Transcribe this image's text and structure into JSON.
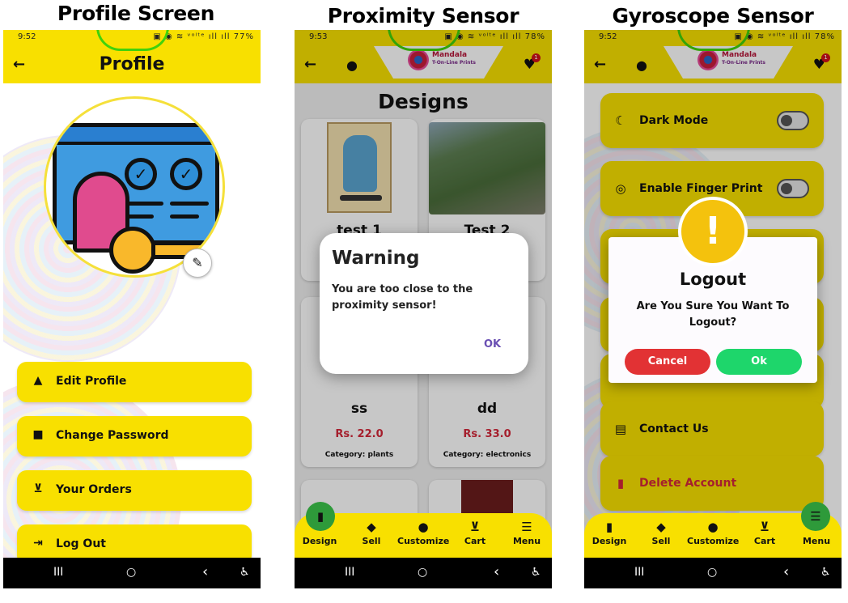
{
  "captions": [
    "Profile Screen",
    "Proximity Sensor",
    "Gyroscope Sensor"
  ],
  "phones": [
    {
      "time": "9:52",
      "battery": "77%",
      "status_icons": "▣ ◉ ≋ ᵛᵒˡᵗᵉ ıll ıll",
      "title": "Profile",
      "menu": [
        {
          "label": "Edit Profile",
          "icon": "person-icon",
          "glyph": "👤"
        },
        {
          "label": "Change Password",
          "icon": "lock-icon",
          "glyph": "🔒"
        },
        {
          "label": "Your Orders",
          "icon": "cart-icon",
          "glyph": "🛒"
        },
        {
          "label": "Log Out",
          "icon": "logout-icon",
          "glyph": "⇥"
        }
      ]
    },
    {
      "time": "9:53",
      "battery": "78%",
      "status_icons": "▣ ◉ ≋ ᵛᵒˡᵗᵉ ıll ıll",
      "logo_text": "Mandala",
      "logo_sub": "T-On-Line Prints",
      "cart_badge": "1",
      "page_title": "Designs",
      "products": [
        {
          "name": "test 1",
          "price": "",
          "category": ""
        },
        {
          "name": "Test 2",
          "price": "",
          "category": ""
        },
        {
          "name": "ss",
          "price": "Rs. 22.0",
          "category": "Category: plants"
        },
        {
          "name": "dd",
          "price": "Rs. 33.0",
          "category": "Category: electronics"
        }
      ],
      "dialog": {
        "title": "Warning",
        "message": "You are too close to the proximity sensor!",
        "ok": "OK"
      }
    },
    {
      "time": "9:52",
      "battery": "78%",
      "status_icons": "▣ ◉ ≋ ᵛᵒˡᵗᵉ ıll ıll",
      "logo_text": "Mandala",
      "logo_sub": "T-On-Line Prints",
      "cart_badge": "1",
      "settings": [
        {
          "label": "Dark Mode",
          "icon": "moon-icon",
          "glyph": "☾",
          "toggle": true
        },
        {
          "label": "Enable Finger Print",
          "icon": "fingerprint-icon",
          "glyph": "◎",
          "toggle": true
        },
        {
          "label": "Contact Us",
          "icon": "chat-icon",
          "glyph": "▤",
          "toggle": false
        },
        {
          "label": "Delete Account",
          "icon": "trash-icon",
          "glyph": "🗑",
          "toggle": false,
          "color": "#d4283a"
        }
      ],
      "dialog": {
        "title": "Logout",
        "message": "Are You Sure You Want To Logout?",
        "cancel": "Cancel",
        "ok": "Ok",
        "cancel_color": "#e23234",
        "ok_color": "#1ed66b",
        "warn_color": "#f4c20d"
      }
    }
  ],
  "bottom_nav": [
    {
      "label": "Design",
      "icon": "paint-roller-icon",
      "glyph": "🖌"
    },
    {
      "label": "Sell",
      "icon": "tag-icon",
      "glyph": "🏷"
    },
    {
      "label": "Customize",
      "icon": "palette-icon",
      "glyph": "🎨"
    },
    {
      "label": "Cart",
      "icon": "cart-icon",
      "glyph": "🛒"
    },
    {
      "label": "Menu",
      "icon": "menu-icon",
      "glyph": "☰"
    }
  ],
  "system_nav": {
    "recents": "III",
    "home": "○",
    "back": "‹",
    "accessibility": "♿"
  },
  "colors": {
    "appbar": "#f8e000",
    "accent_green": "#2e9a3a",
    "price_red": "#d4283a"
  }
}
